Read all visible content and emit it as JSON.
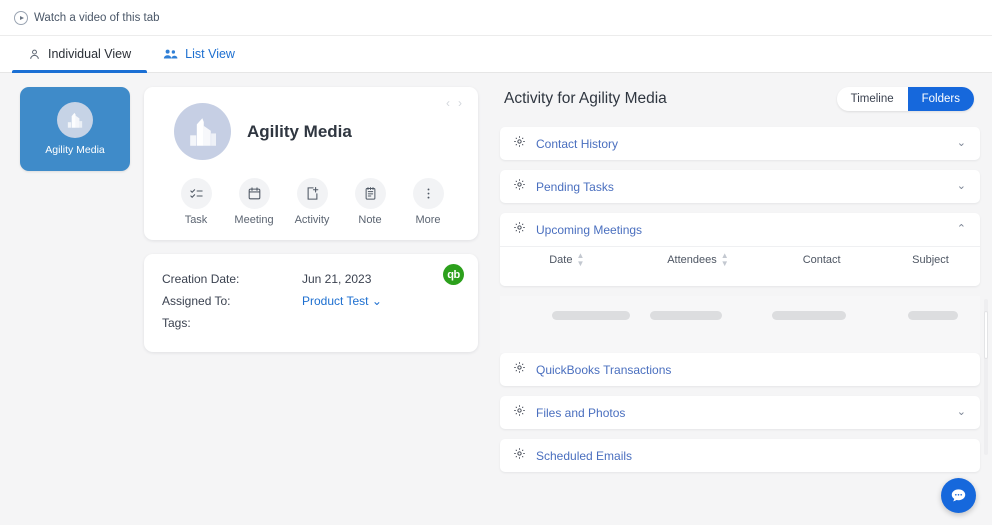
{
  "topbar": {
    "watch_label": "Watch a video of this tab",
    "play_icon": "play-circle-icon"
  },
  "tabs": [
    {
      "label": "Individual View",
      "icon": "person-icon",
      "active": true
    },
    {
      "label": "List View",
      "icon": "people-group-icon",
      "active": false
    }
  ],
  "sidebar": {
    "tile": {
      "label": "Agility Media",
      "avatar_icon": "building-icon"
    }
  },
  "contact_card": {
    "name": "Agility Media",
    "avatar_icon": "building-icon",
    "nav_prev": "‹",
    "nav_next": "›",
    "actions": [
      {
        "label": "Task",
        "icon": "checklist-icon"
      },
      {
        "label": "Meeting",
        "icon": "calendar-icon"
      },
      {
        "label": "Activity",
        "icon": "file-plus-icon"
      },
      {
        "label": "Note",
        "icon": "notepad-icon"
      },
      {
        "label": "More",
        "icon": "dots-vertical-icon"
      }
    ]
  },
  "detail_card": {
    "badge": "qb",
    "badge_icon": "quickbooks-icon",
    "rows": [
      {
        "key": "Creation Date:",
        "value": "Jun 21, 2023",
        "link": false
      },
      {
        "key": "Assigned To:",
        "value": "Product Test ⌄",
        "link": true
      },
      {
        "key": "Tags:",
        "value": "",
        "link": false
      }
    ]
  },
  "activity": {
    "title": "Activity for Agility Media",
    "segments": [
      {
        "label": "Timeline",
        "active": false
      },
      {
        "label": "Folders",
        "active": true
      }
    ],
    "sections": [
      {
        "title": "Contact History",
        "icon": "gear-icon",
        "expanded": false,
        "chevron": "⌄"
      },
      {
        "title": "Pending Tasks",
        "icon": "gear-icon",
        "expanded": false,
        "chevron": "⌄"
      },
      {
        "title": "Upcoming Meetings",
        "icon": "gear-icon",
        "expanded": true,
        "chevron": "⌃"
      },
      {
        "title": "QuickBooks Transactions",
        "icon": "gear-icon",
        "expanded": false,
        "chevron": ""
      },
      {
        "title": "Files and Photos",
        "icon": "gear-icon",
        "expanded": false,
        "chevron": "⌄"
      },
      {
        "title": "Scheduled Emails",
        "icon": "gear-icon",
        "expanded": false,
        "chevron": ""
      }
    ],
    "meetings_table": {
      "columns": [
        {
          "label": "Date",
          "sortable": true
        },
        {
          "label": "Attendees",
          "sortable": true
        },
        {
          "label": "Contact",
          "sortable": false
        },
        {
          "label": "Subject",
          "sortable": false
        }
      ],
      "rows": [],
      "loading": true
    }
  },
  "fab": {
    "icon": "chat-bubble-icon"
  },
  "colors": {
    "tile_blue": "#3f8bc9",
    "accent_blue": "#1668dc",
    "link_blue": "#4a6fbf",
    "quickbooks_green": "#2ca01c",
    "page_bg": "#f5f5f6"
  }
}
